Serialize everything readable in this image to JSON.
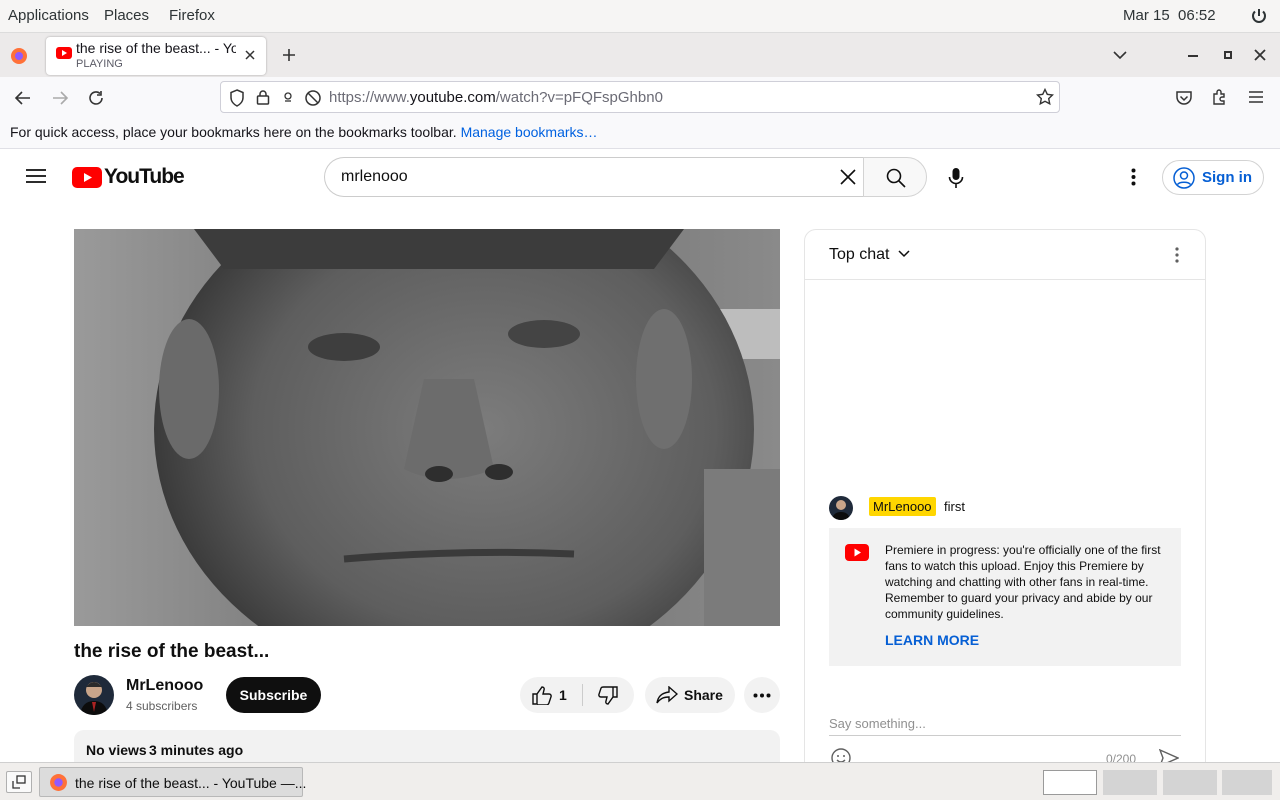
{
  "system_bar": {
    "menus": [
      "Applications",
      "Places",
      "Firefox"
    ],
    "datetime": "Mar 15  06:52"
  },
  "browser": {
    "tab": {
      "title": "the rise of the beast... - YouTube",
      "status": "PLAYING"
    },
    "url_prefix": "https://www.",
    "url_domain": "youtube.com",
    "url_path": "/watch?v=pFQFspGhbn0",
    "bookmarks_text": "For quick access, place your bookmarks here on the bookmarks toolbar.",
    "bookmarks_link": "Manage bookmarks…"
  },
  "youtube": {
    "logo_text": "YouTube",
    "search_value": "mrlenooo",
    "sign_in": "Sign in",
    "video": {
      "title": "the rise of the beast...",
      "channel": "MrLenooo",
      "subscribers": "4 subscribers",
      "subscribe": "Subscribe",
      "likes": "1",
      "share": "Share",
      "views": "No views",
      "age": "3 minutes ago"
    },
    "chat": {
      "header": "Top chat",
      "message_author": "MrLenooo",
      "message_text": "first",
      "notice": "Premiere in progress: you're officially one of the first fans to watch this upload. Enjoy this Premiere by watching and chatting with other fans in real-time. Remember to guard your privacy and abide by our community guidelines.",
      "learn_more": "LEARN MORE",
      "placeholder": "Say something...",
      "counter": "0/200"
    }
  },
  "taskbar": {
    "window_title": "the rise of the beast... - YouTube —..."
  },
  "colors": {
    "youtube_red": "#ff0000",
    "link_blue": "#065fd4",
    "author_badge": "#ffd600"
  }
}
